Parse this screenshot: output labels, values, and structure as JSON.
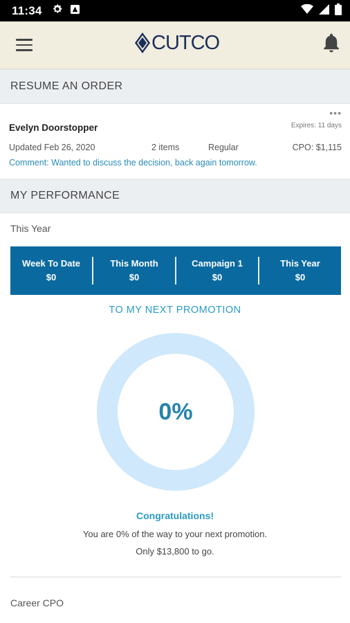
{
  "status_bar": {
    "time": "11:34",
    "left_icons": [
      "gear-icon",
      "notification-app-icon"
    ],
    "right_icons": [
      "wifi-icon",
      "cell-signal-icon",
      "battery-icon"
    ]
  },
  "app_bar": {
    "logo_text": "CUTCO",
    "menu_icon": "hamburger-menu-icon",
    "notification_icon": "bell-icon",
    "background_color": "#f1eddf"
  },
  "resume_order": {
    "header": "RESUME AN ORDER",
    "order": {
      "customer_name": "Evelyn Doorstopper",
      "expires": "Expires: 11 days",
      "updated": "Updated Feb 26, 2020",
      "items": "2 items",
      "type": "Regular",
      "cpo": "CPO: $1,115",
      "comment": "Comment: Wanted to discuss the decision, back again tomorrow.",
      "more_icon": "more-horizontal-icon"
    }
  },
  "performance": {
    "header": "MY PERFORMANCE",
    "period_label": "This Year",
    "stats": [
      {
        "label": "Week To Date",
        "value": "$0"
      },
      {
        "label": "This Month",
        "value": "$0"
      },
      {
        "label": "Campaign 1",
        "value": "$0"
      },
      {
        "label": "This Year",
        "value": "$0"
      }
    ],
    "stats_color": "#0a6aa0",
    "promotion": {
      "link_label": "TO MY NEXT PROMOTION",
      "progress_percent": 0,
      "progress_label": "0%",
      "congrats": "Congratulations!",
      "line1": "You are 0% of the way to your next promotion.",
      "line2": "Only $13,800 to go.",
      "ring_color": "#cfe8fb",
      "accent_color": "#2a9bc6"
    },
    "career_label": "Career CPO"
  }
}
